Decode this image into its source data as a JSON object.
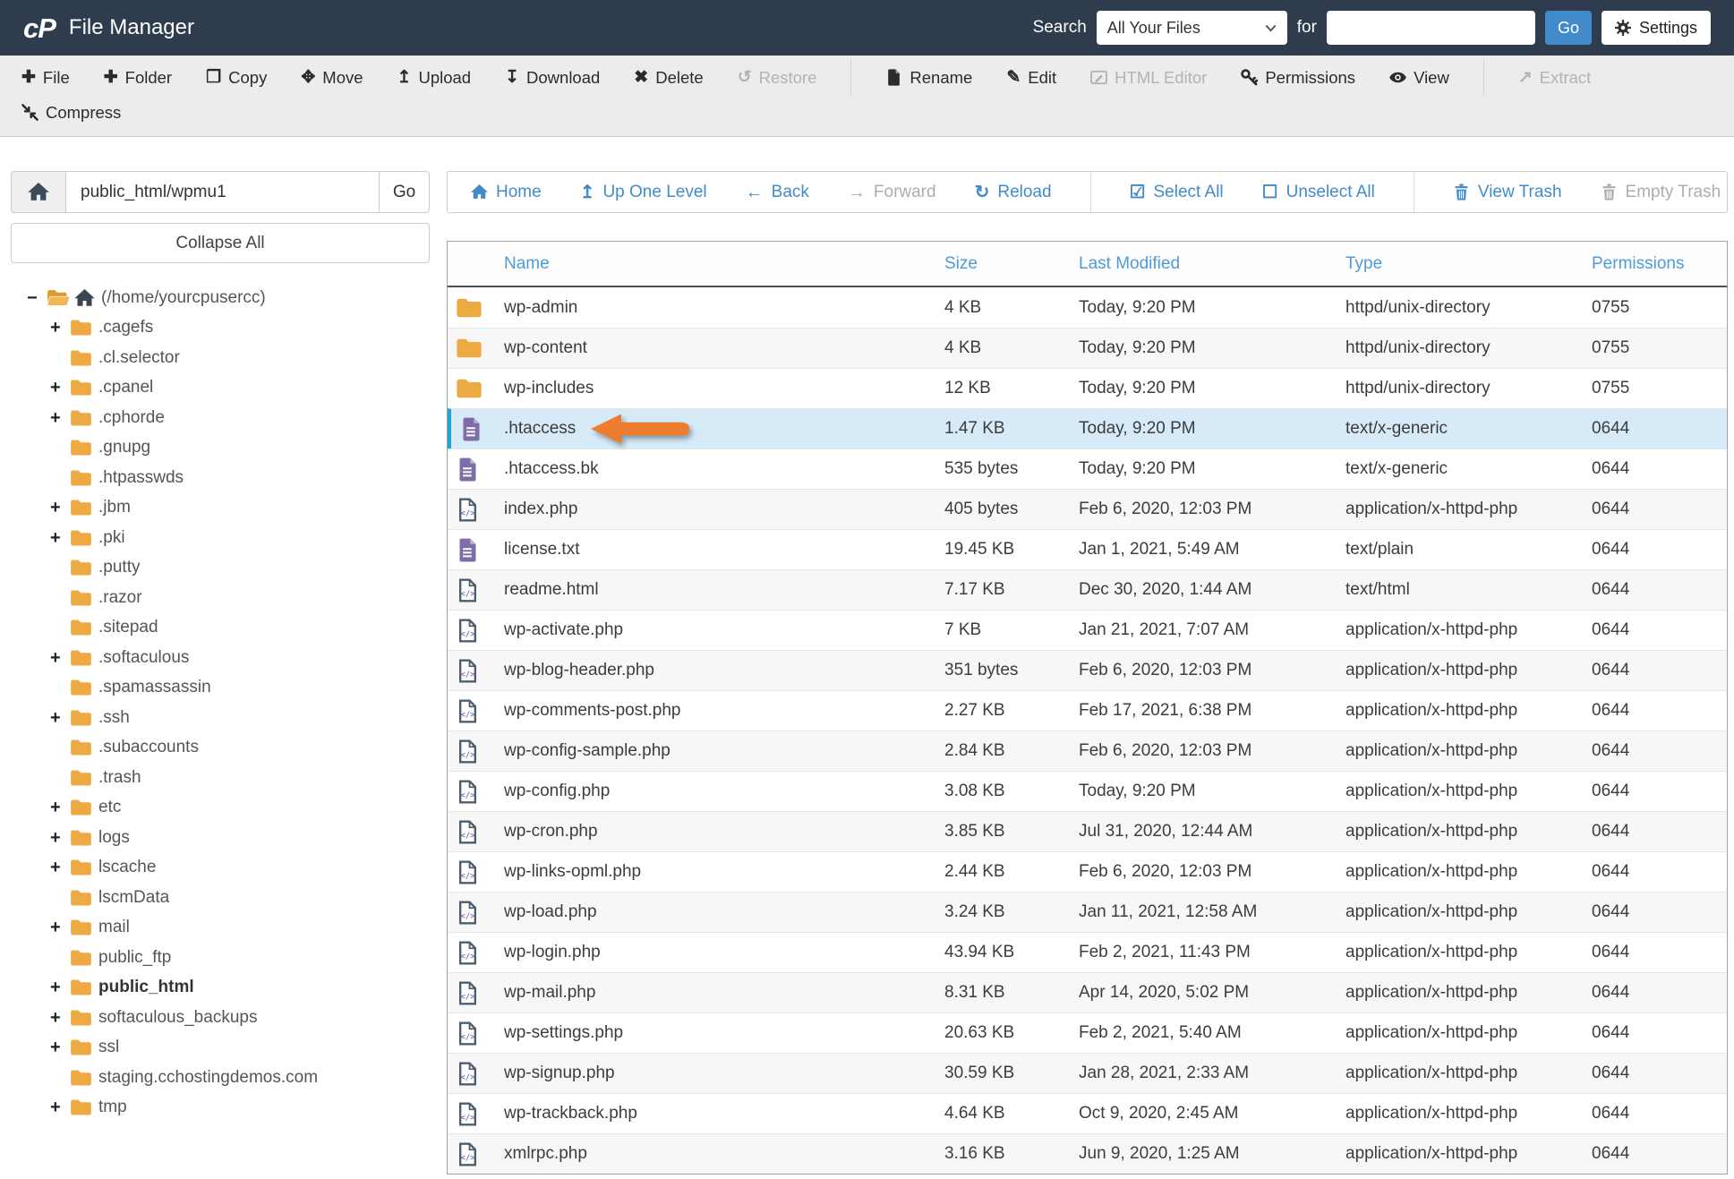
{
  "header": {
    "app_title": "File Manager",
    "search_label": "Search",
    "search_scope_selected": "All Your Files",
    "for_label": "for",
    "search_value": "",
    "go_label": "Go",
    "settings_label": "Settings"
  },
  "toolbar": {
    "items": [
      {
        "label": "File",
        "icon": "plus-icon",
        "enabled": true,
        "row": 1
      },
      {
        "label": "Folder",
        "icon": "plus-icon",
        "enabled": true,
        "row": 1
      },
      {
        "label": "Copy",
        "icon": "copy-icon",
        "enabled": true,
        "row": 1
      },
      {
        "label": "Move",
        "icon": "move-icon",
        "enabled": true,
        "row": 1
      },
      {
        "label": "Upload",
        "icon": "upload-icon",
        "enabled": true,
        "row": 1
      },
      {
        "label": "Download",
        "icon": "download-icon",
        "enabled": true,
        "row": 1
      },
      {
        "label": "Delete",
        "icon": "delete-x-icon",
        "enabled": true,
        "row": 1
      },
      {
        "label": "Restore",
        "icon": "restore-undo-icon",
        "enabled": false,
        "row": 1,
        "sep_after": true
      },
      {
        "label": "Rename",
        "icon": "rename-file-icon",
        "enabled": true,
        "row": 1
      },
      {
        "label": "Edit",
        "icon": "edit-pencil-icon",
        "enabled": true,
        "row": 1
      },
      {
        "label": "HTML Editor",
        "icon": "html-editor-icon",
        "enabled": false,
        "row": 1
      },
      {
        "label": "Permissions",
        "icon": "permissions-key-icon",
        "enabled": true,
        "row": 1
      },
      {
        "label": "View",
        "icon": "view-eye-icon",
        "enabled": true,
        "row": 1,
        "sep_after": true
      },
      {
        "label": "Extract",
        "icon": "extract-icon",
        "enabled": false,
        "row": 1
      },
      {
        "label": "Compress",
        "icon": "compress-icon",
        "enabled": true,
        "row": 2
      }
    ]
  },
  "sidebar": {
    "path_value": "public_html/wpmu1",
    "go_label": "Go",
    "collapse_all_label": "Collapse All",
    "tree": {
      "items": [
        {
          "label": "(/home/yourcpusercc)",
          "root": true,
          "toggle": "−"
        },
        {
          "label": ".cagefs",
          "toggle": "+"
        },
        {
          "label": ".cl.selector"
        },
        {
          "label": ".cpanel",
          "toggle": "+"
        },
        {
          "label": ".cphorde",
          "toggle": "+"
        },
        {
          "label": ".gnupg"
        },
        {
          "label": ".htpasswds"
        },
        {
          "label": ".jbm",
          "toggle": "+"
        },
        {
          "label": ".pki",
          "toggle": "+"
        },
        {
          "label": ".putty"
        },
        {
          "label": ".razor"
        },
        {
          "label": ".sitepad"
        },
        {
          "label": ".softaculous",
          "toggle": "+"
        },
        {
          "label": ".spamassassin"
        },
        {
          "label": ".ssh",
          "toggle": "+"
        },
        {
          "label": ".subaccounts"
        },
        {
          "label": ".trash"
        },
        {
          "label": "etc",
          "toggle": "+"
        },
        {
          "label": "logs",
          "toggle": "+"
        },
        {
          "label": "lscache",
          "toggle": "+"
        },
        {
          "label": "lscmData"
        },
        {
          "label": "mail",
          "toggle": "+"
        },
        {
          "label": "public_ftp"
        },
        {
          "label": "public_html",
          "toggle": "+",
          "bold": true
        },
        {
          "label": "softaculous_backups",
          "toggle": "+"
        },
        {
          "label": "ssl",
          "toggle": "+"
        },
        {
          "label": "staging.cchostingdemos.com"
        },
        {
          "label": "tmp",
          "toggle": "+"
        }
      ]
    }
  },
  "nav": {
    "items": [
      {
        "label": "Home",
        "icon": "home-icon",
        "enabled": true
      },
      {
        "label": "Up One Level",
        "icon": "up-one-level-icon",
        "enabled": true
      },
      {
        "label": "Back",
        "icon": "back-arrow-icon",
        "enabled": true
      },
      {
        "label": "Forward",
        "icon": "forward-arrow-icon",
        "enabled": false
      },
      {
        "label": "Reload",
        "icon": "reload-icon",
        "enabled": true,
        "sep_after": true
      },
      {
        "label": "Select All",
        "icon": "select-all-icon",
        "enabled": true
      },
      {
        "label": "Unselect All",
        "icon": "unselect-all-icon",
        "enabled": true,
        "sep_after": true
      },
      {
        "label": "View Trash",
        "icon": "trash-icon",
        "enabled": true
      },
      {
        "label": "Empty Trash",
        "icon": "trash-icon",
        "enabled": false
      }
    ]
  },
  "table": {
    "columns": [
      "Name",
      "Size",
      "Last Modified",
      "Type",
      "Permissions"
    ],
    "rows": [
      {
        "name": "wp-admin",
        "size": "4 KB",
        "modified": "Today, 9:20 PM",
        "type": "httpd/unix-directory",
        "perms": "0755",
        "icon": "folder-icon"
      },
      {
        "name": "wp-content",
        "size": "4 KB",
        "modified": "Today, 9:20 PM",
        "type": "httpd/unix-directory",
        "perms": "0755",
        "icon": "folder-icon"
      },
      {
        "name": "wp-includes",
        "size": "12 KB",
        "modified": "Today, 9:20 PM",
        "type": "httpd/unix-directory",
        "perms": "0755",
        "icon": "folder-icon"
      },
      {
        "name": ".htaccess",
        "size": "1.47 KB",
        "modified": "Today, 9:20 PM",
        "type": "text/x-generic",
        "perms": "0644",
        "icon": "doc-icon",
        "highlighted": true,
        "arrow": true
      },
      {
        "name": ".htaccess.bk",
        "size": "535 bytes",
        "modified": "Today, 9:20 PM",
        "type": "text/x-generic",
        "perms": "0644",
        "icon": "doc-icon"
      },
      {
        "name": "index.php",
        "size": "405 bytes",
        "modified": "Feb 6, 2020, 12:03 PM",
        "type": "application/x-httpd-php",
        "perms": "0644",
        "icon": "code-icon"
      },
      {
        "name": "license.txt",
        "size": "19.45 KB",
        "modified": "Jan 1, 2021, 5:49 AM",
        "type": "text/plain",
        "perms": "0644",
        "icon": "doc-icon"
      },
      {
        "name": "readme.html",
        "size": "7.17 KB",
        "modified": "Dec 30, 2020, 1:44 AM",
        "type": "text/html",
        "perms": "0644",
        "icon": "code-icon"
      },
      {
        "name": "wp-activate.php",
        "size": "7 KB",
        "modified": "Jan 21, 2021, 7:07 AM",
        "type": "application/x-httpd-php",
        "perms": "0644",
        "icon": "code-icon"
      },
      {
        "name": "wp-blog-header.php",
        "size": "351 bytes",
        "modified": "Feb 6, 2020, 12:03 PM",
        "type": "application/x-httpd-php",
        "perms": "0644",
        "icon": "code-icon"
      },
      {
        "name": "wp-comments-post.php",
        "size": "2.27 KB",
        "modified": "Feb 17, 2021, 6:38 PM",
        "type": "application/x-httpd-php",
        "perms": "0644",
        "icon": "code-icon"
      },
      {
        "name": "wp-config-sample.php",
        "size": "2.84 KB",
        "modified": "Feb 6, 2020, 12:03 PM",
        "type": "application/x-httpd-php",
        "perms": "0644",
        "icon": "code-icon"
      },
      {
        "name": "wp-config.php",
        "size": "3.08 KB",
        "modified": "Today, 9:20 PM",
        "type": "application/x-httpd-php",
        "perms": "0644",
        "icon": "code-icon"
      },
      {
        "name": "wp-cron.php",
        "size": "3.85 KB",
        "modified": "Jul 31, 2020, 12:44 AM",
        "type": "application/x-httpd-php",
        "perms": "0644",
        "icon": "code-icon"
      },
      {
        "name": "wp-links-opml.php",
        "size": "2.44 KB",
        "modified": "Feb 6, 2020, 12:03 PM",
        "type": "application/x-httpd-php",
        "perms": "0644",
        "icon": "code-icon"
      },
      {
        "name": "wp-load.php",
        "size": "3.24 KB",
        "modified": "Jan 11, 2021, 12:58 AM",
        "type": "application/x-httpd-php",
        "perms": "0644",
        "icon": "code-icon"
      },
      {
        "name": "wp-login.php",
        "size": "43.94 KB",
        "modified": "Feb 2, 2021, 11:43 PM",
        "type": "application/x-httpd-php",
        "perms": "0644",
        "icon": "code-icon"
      },
      {
        "name": "wp-mail.php",
        "size": "8.31 KB",
        "modified": "Apr 14, 2020, 5:02 PM",
        "type": "application/x-httpd-php",
        "perms": "0644",
        "icon": "code-icon"
      },
      {
        "name": "wp-settings.php",
        "size": "20.63 KB",
        "modified": "Feb 2, 2021, 5:40 AM",
        "type": "application/x-httpd-php",
        "perms": "0644",
        "icon": "code-icon"
      },
      {
        "name": "wp-signup.php",
        "size": "30.59 KB",
        "modified": "Jan 28, 2021, 2:33 AM",
        "type": "application/x-httpd-php",
        "perms": "0644",
        "icon": "code-icon"
      },
      {
        "name": "wp-trackback.php",
        "size": "4.64 KB",
        "modified": "Oct 9, 2020, 2:45 AM",
        "type": "application/x-httpd-php",
        "perms": "0644",
        "icon": "code-icon"
      },
      {
        "name": "xmlrpc.php",
        "size": "3.16 KB",
        "modified": "Jun 9, 2020, 1:25 AM",
        "type": "application/x-httpd-php",
        "perms": "0644",
        "icon": "code-icon"
      }
    ]
  },
  "colors": {
    "header_bg": "#2e3c4e",
    "accent_blue": "#428bca",
    "table_header_blue": "#4e9bd5",
    "folder_orange": "#edaa43",
    "doc_purple": "#7e6da6",
    "highlight_row": "#d6eaf7",
    "highlight_border": "#23a3d6",
    "annotation_arrow_orange": "#ee7c2f"
  }
}
